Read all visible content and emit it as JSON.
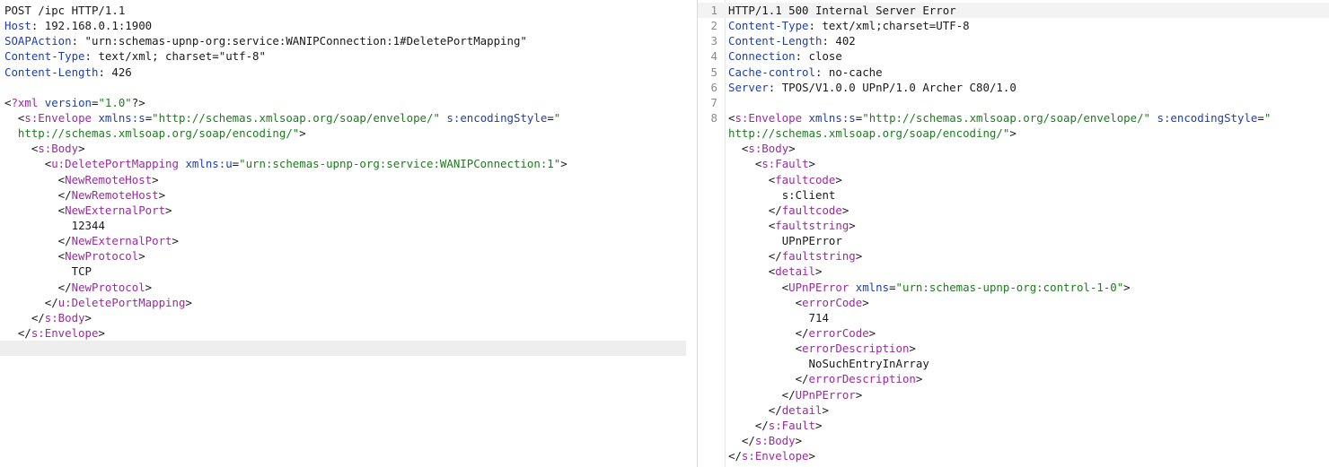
{
  "request": {
    "request_line": "POST /ipc HTTP/1.1",
    "headers": [
      {
        "name": "Host",
        "value": "192.168.0.1:1900"
      },
      {
        "name": "SOAPAction",
        "value": "\"urn:schemas-upnp-org:service:WANIPConnection:1#DeletePortMapping\""
      },
      {
        "name": "Content-Type",
        "value": "text/xml; charset=\"utf-8\""
      },
      {
        "name": "Content-Length",
        "value": "426"
      }
    ],
    "xml_decl": {
      "tag": "?xml",
      "attr": "version",
      "value": "\"1.0\"",
      "end": "?>"
    },
    "envelope": {
      "tag": "s:Envelope",
      "ns_attr": "xmlns:s",
      "ns_value": "\"http://schemas.xmlsoap.org/soap/envelope/\"",
      "enc_attr": "s:encodingStyle",
      "enc_value_start": "\"",
      "enc_value_rest": "http://schemas.xmlsoap.org/soap/encoding/\""
    },
    "body_tag": "s:Body",
    "action": {
      "tag": "u:DeletePortMapping",
      "ns_attr": "xmlns:u",
      "ns_value": "\"urn:schemas-upnp-org:service:WANIPConnection:1\""
    },
    "remote_host_tag": "NewRemoteHost",
    "external_port_tag": "NewExternalPort",
    "external_port_value": "12344",
    "protocol_tag": "NewProtocol",
    "protocol_value": "TCP"
  },
  "response": {
    "line_numbers": [
      "1",
      "2",
      "3",
      "4",
      "5",
      "6",
      "7",
      "8"
    ],
    "status_line": "HTTP/1.1 500 Internal Server Error",
    "headers": [
      {
        "name": "Content-Type",
        "value": "text/xml;charset=UTF-8"
      },
      {
        "name": "Content-Length",
        "value": "402"
      },
      {
        "name": "Connection",
        "value": "close"
      },
      {
        "name": "Cache-control",
        "value": "no-cache"
      },
      {
        "name": "Server",
        "value": "TPOS/V1.0.0 UPnP/1.0 Archer C80/1.0"
      }
    ],
    "envelope": {
      "tag": "s:Envelope",
      "ns_attr": "xmlns:s",
      "ns_value": "\"http://schemas.xmlsoap.org/soap/envelope/\"",
      "enc_attr": "s:encodingStyle",
      "enc_value_start": "\"",
      "enc_value_rest": "http://schemas.xmlsoap.org/soap/encoding/\""
    },
    "body_tag": "s:Body",
    "fault_tag": "s:Fault",
    "faultcode_tag": "faultcode",
    "faultcode_value": "s:Client",
    "faultstring_tag": "faultstring",
    "faultstring_value": "UPnPError",
    "detail_tag": "detail",
    "upnp_error": {
      "tag": "UPnPError",
      "ns_attr": "xmlns",
      "ns_value": "\"urn:schemas-upnp-org:control-1-0\""
    },
    "error_code_tag": "errorCode",
    "error_code_value": "714",
    "error_desc_tag": "errorDescription",
    "error_desc_value": "NoSuchEntryInArray"
  }
}
